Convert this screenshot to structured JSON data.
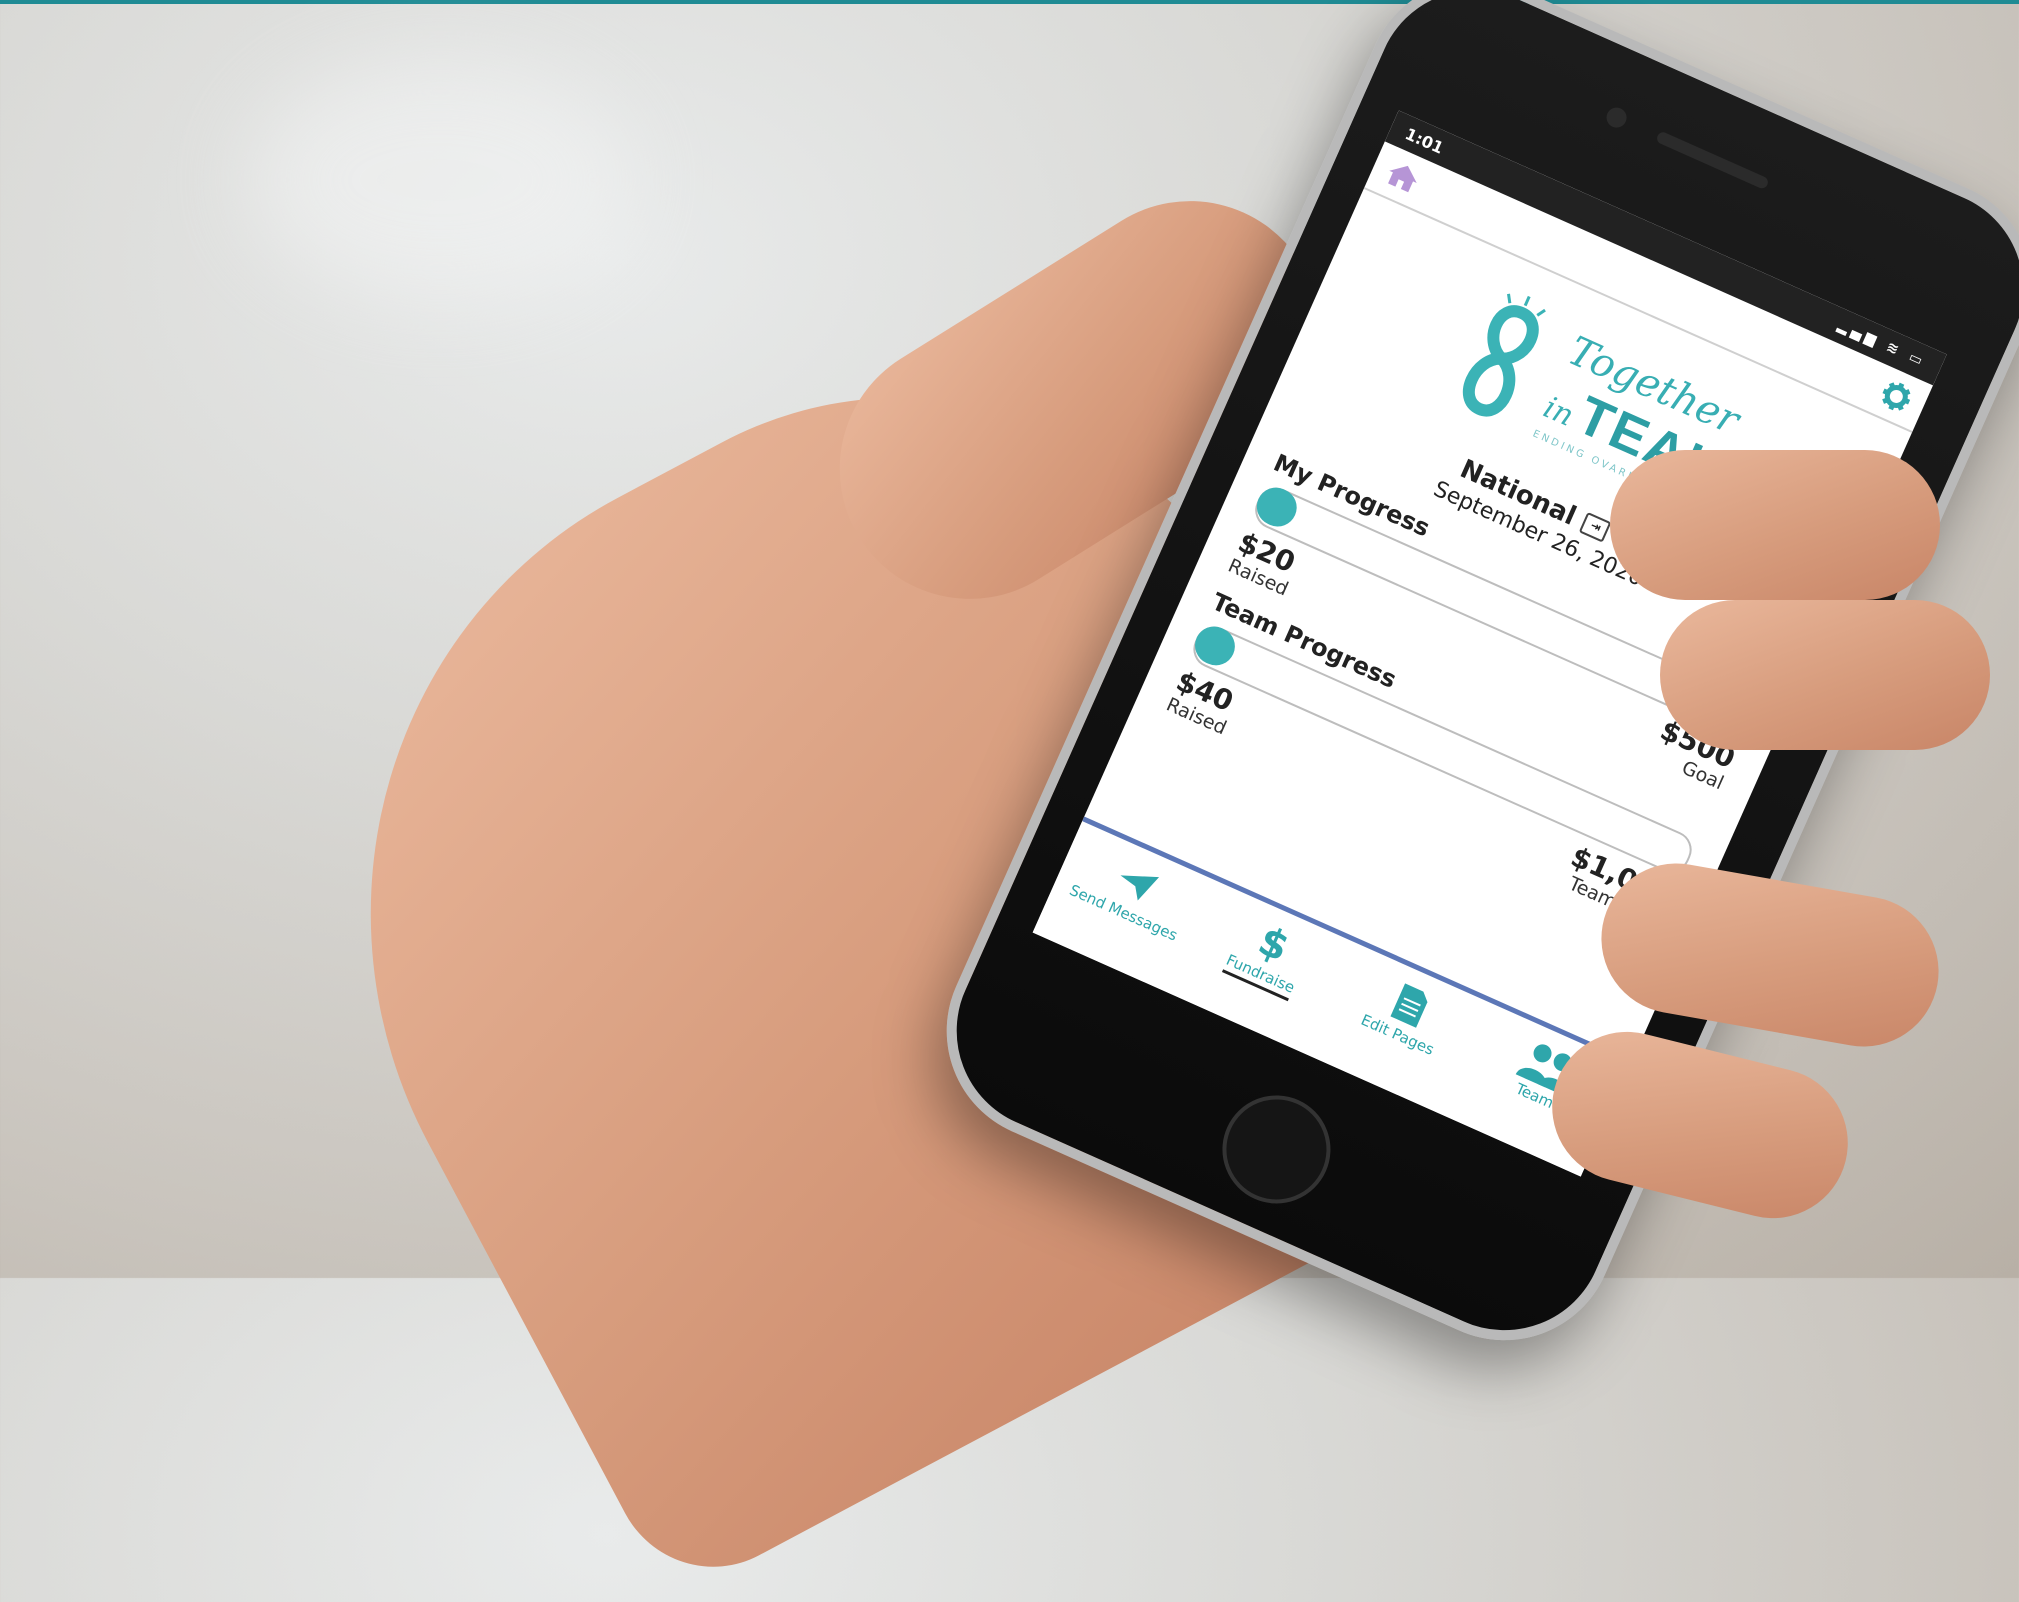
{
  "status": {
    "time": "1:01",
    "icons": "▂▄▆ ≋ ▭"
  },
  "logo": {
    "line1": "Together",
    "line2_in": "in",
    "line2_teal": "TEAL",
    "tagline": "ENDING OVARIAN CANCER"
  },
  "event": {
    "name": "National",
    "date": "September 26, 2020"
  },
  "my_progress": {
    "title": "My Progress",
    "raised": "$20",
    "raised_label": "Raised",
    "goal": "$500",
    "goal_label": "Goal",
    "fraction": 0.04
  },
  "team_progress": {
    "title": "Team Progress",
    "raised": "$40",
    "raised_label": "Raised",
    "goal": "$1,000",
    "goal_label": "Team Goal",
    "fraction": 0.04
  },
  "nav": {
    "items": [
      {
        "label": "Send Messages",
        "icon": "paper-plane-icon"
      },
      {
        "label": "Fundraise",
        "icon": "dollar-icon"
      },
      {
        "label": "Edit Pages",
        "icon": "document-icon"
      },
      {
        "label": "Team",
        "icon": "team-icon"
      }
    ],
    "active": 1
  },
  "colors": {
    "accent": "#3bb3b6",
    "nav_border": "#5c77b7",
    "home_icon": "#b695d6"
  }
}
